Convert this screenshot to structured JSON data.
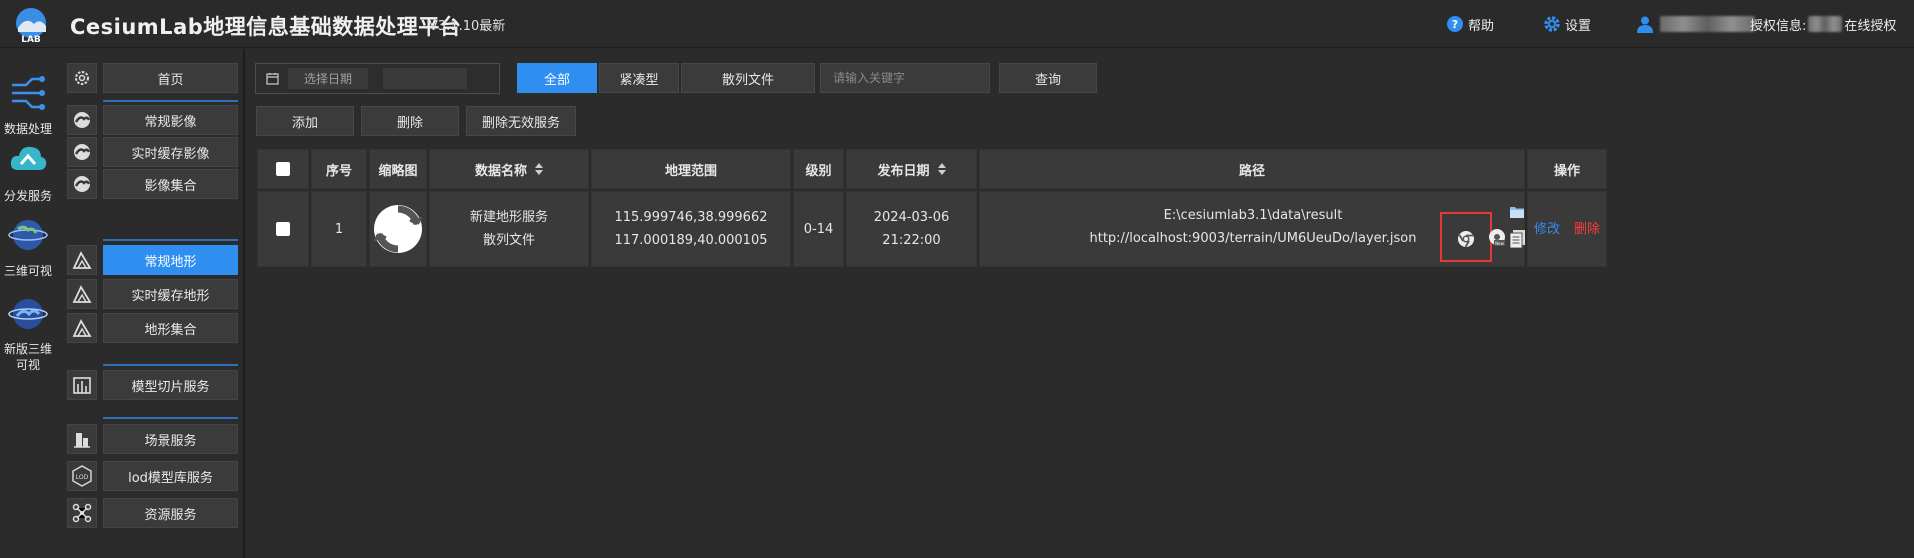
{
  "header": {
    "logo_text": "LAB",
    "title": "CesiumLab地理信息基础数据处理平台",
    "version": "V3.1.10最新",
    "help_label": "帮助",
    "settings_label": "设置",
    "license_label": "授权信息:",
    "license_value": "在线授权"
  },
  "rail": {
    "items": [
      {
        "label": "数据处理",
        "icon": "data-process-icon"
      },
      {
        "label": "分发服务",
        "icon": "cloud-icon"
      },
      {
        "label": "三维可视",
        "icon": "earth-icon"
      },
      {
        "label": "新版三维可视",
        "icon": "new-earth-icon"
      }
    ]
  },
  "menu": {
    "home": "首页",
    "imagery": [
      "常规影像",
      "实时缓存影像",
      "影像集合"
    ],
    "terrain": [
      "常规地形",
      "实时缓存地形",
      "地形集合"
    ],
    "model": [
      "模型切片服务"
    ],
    "others": [
      "场景服务",
      "lod模型库服务",
      "资源服务"
    ]
  },
  "toolbar": {
    "date_placeholder": "选择日期",
    "tabs": [
      "全部",
      "紧凑型",
      "散列文件"
    ],
    "keyword_placeholder": "请输入关键字",
    "query": "查询",
    "add": "添加",
    "delete": "删除",
    "delete_invalid": "删除无效服务"
  },
  "table": {
    "headers": [
      "序号",
      "缩略图",
      "数据名称",
      "地理范围",
      "级别",
      "发布日期",
      "路径",
      "操作"
    ],
    "rows": [
      {
        "index": "1",
        "name": "新建地形服务",
        "type": "散列文件",
        "extent_min": "115.999746,38.999662",
        "extent_max": "117.000189,40.000105",
        "level": "0-14",
        "date": "2024-03-06 21:22:00",
        "path": "E:\\cesiumlab3.1\\data\\result",
        "url": "http://localhost:9003/terrain/UM6UeuDo/layer.json",
        "edit": "修改",
        "remove": "删除"
      }
    ]
  },
  "colors": {
    "accent": "#2f8ff0",
    "danger": "#ff3b3b",
    "highlight": "#e53935"
  }
}
